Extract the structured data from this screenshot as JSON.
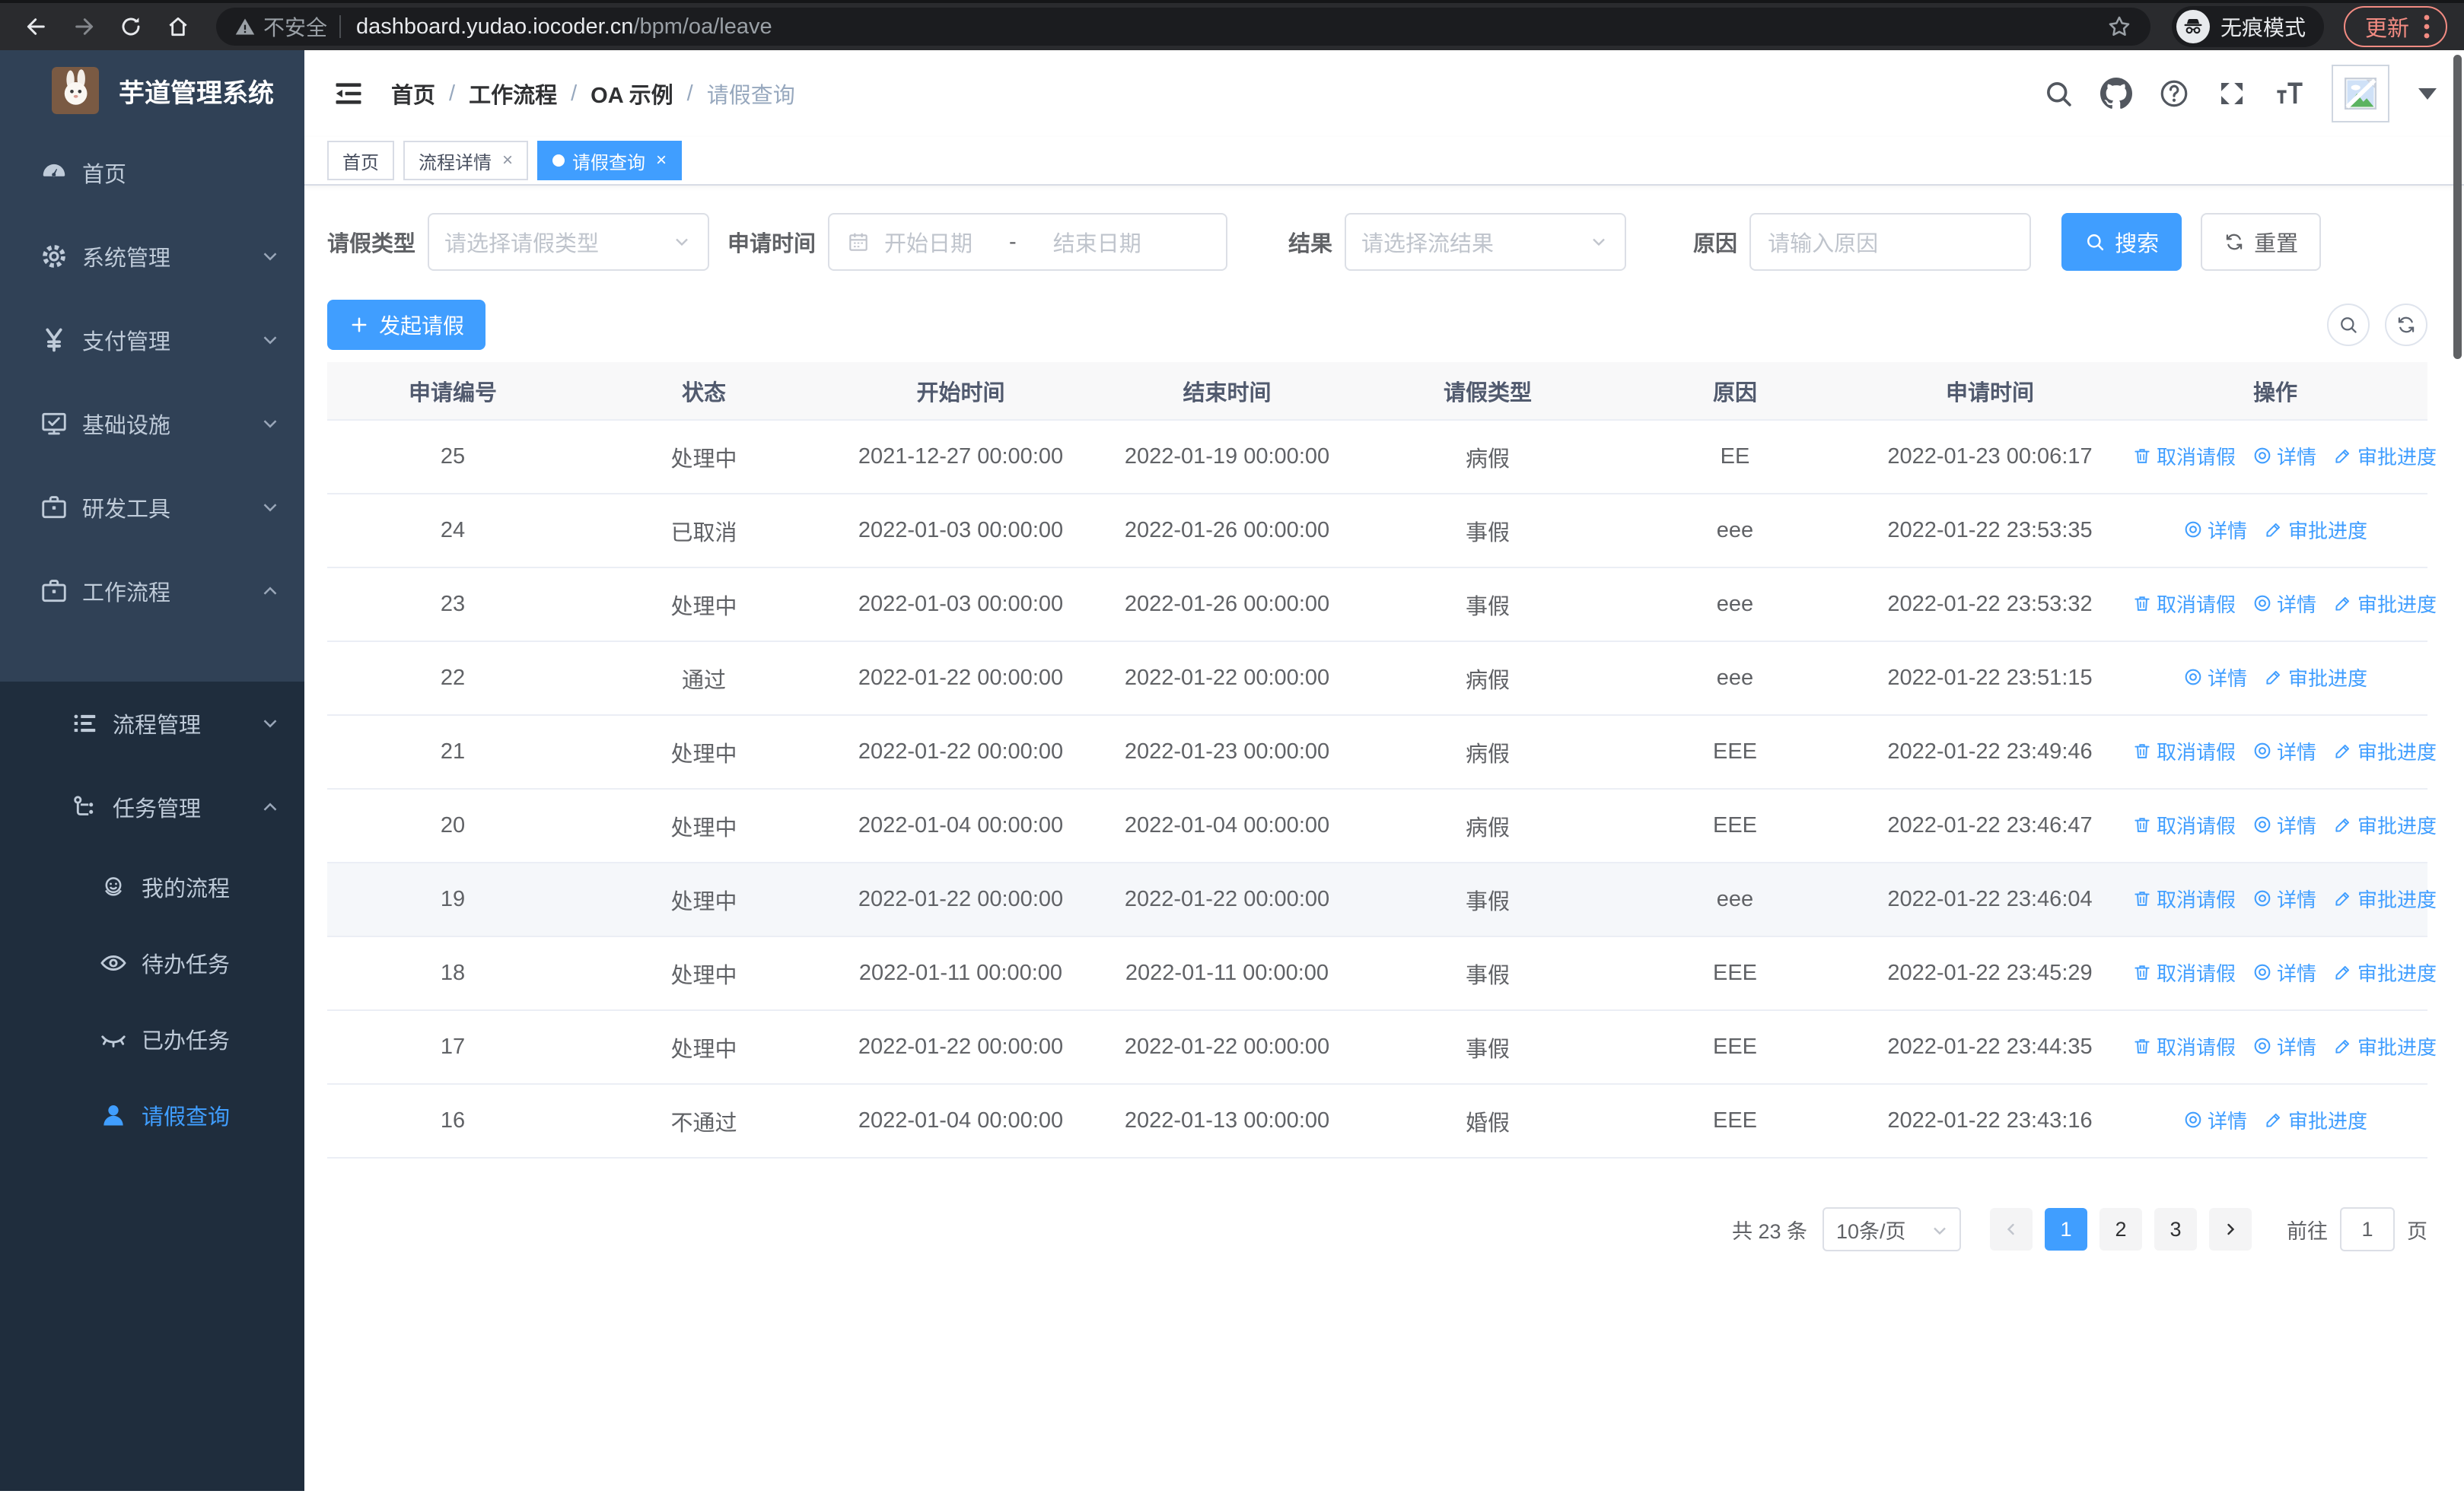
{
  "browser": {
    "security_label": "不安全",
    "url_host": "dashboard.yudao.iocoder.cn",
    "url_path": "/bpm/oa/leave",
    "incognito_label": "无痕模式",
    "update_label": "更新"
  },
  "colors": {
    "accent": "#409eff",
    "sidebar_bg": "#304156",
    "submenu_bg": "#1f2d3d",
    "sidebar_text": "#bfcbd9",
    "chrome_update": "#f28b82",
    "table_border": "#ebeef5",
    "header_bg": "#f8f8f9"
  },
  "sidebar": {
    "title": "芋道管理系统",
    "menu": [
      {
        "key": "home",
        "icon": "dashboard-icon",
        "label": "首页"
      },
      {
        "key": "system-mgmt",
        "icon": "gear-icon",
        "label": "系统管理",
        "chevron": "down"
      },
      {
        "key": "payment-mgmt",
        "icon": "yen-icon",
        "label": "支付管理",
        "chevron": "down"
      },
      {
        "key": "infrastructure",
        "icon": "monitor-icon",
        "label": "基础设施",
        "chevron": "down"
      },
      {
        "key": "dev-tools",
        "icon": "briefcase-icon",
        "label": "研发工具",
        "chevron": "down"
      },
      {
        "key": "workflow",
        "icon": "briefcase-icon",
        "label": "工作流程",
        "chevron": "up"
      }
    ],
    "submenu": [
      {
        "key": "process-mgmt",
        "icon": "list-icon",
        "label": "流程管理",
        "chevron": "down",
        "level": 1
      },
      {
        "key": "task-mgmt",
        "icon": "tree-icon",
        "label": "任务管理",
        "chevron": "up",
        "level": 1
      },
      {
        "key": "my-process",
        "icon": "face-icon",
        "label": "我的流程",
        "level": 2
      },
      {
        "key": "todo-tasks",
        "icon": "eye-icon",
        "label": "待办任务",
        "level": 2
      },
      {
        "key": "done-tasks",
        "icon": "eye-closed-icon",
        "label": "已办任务",
        "level": 2
      },
      {
        "key": "leave-query",
        "icon": "user-icon",
        "label": "请假查询",
        "level": 2,
        "active": true
      }
    ]
  },
  "header": {
    "breadcrumb": [
      "首页",
      "工作流程",
      "OA 示例",
      "请假查询"
    ]
  },
  "tabs": [
    {
      "key": "home",
      "label": "首页",
      "closable": false,
      "active": false
    },
    {
      "key": "process-detail",
      "label": "流程详情",
      "closable": true,
      "active": false
    },
    {
      "key": "leave-query",
      "label": "请假查询",
      "closable": true,
      "active": true
    }
  ],
  "filters": {
    "leave_type_label": "请假类型",
    "leave_type_placeholder": "请选择请假类型",
    "apply_time_label": "申请时间",
    "date_start_placeholder": "开始日期",
    "date_separator": "-",
    "date_end_placeholder": "结束日期",
    "result_label": "结果",
    "result_placeholder": "请选择流结果",
    "reason_label": "原因",
    "reason_placeholder": "请输入原因",
    "search_label": "搜索",
    "reset_label": "重置"
  },
  "toolbar": {
    "create_label": "发起请假"
  },
  "table": {
    "columns": [
      "申请编号",
      "状态",
      "开始时间",
      "结束时间",
      "请假类型",
      "原因",
      "申请时间",
      "操作"
    ],
    "action_labels": {
      "cancel": "取消请假",
      "detail": "详情",
      "progress": "审批进度"
    },
    "rows": [
      {
        "id": "25",
        "status": "处理中",
        "start": "2021-12-27 00:00:00",
        "end": "2022-01-19 00:00:00",
        "type": "病假",
        "reason": "EE",
        "applied": "2022-01-23 00:06:17",
        "actions": [
          "cancel",
          "detail",
          "progress"
        ],
        "hover": false
      },
      {
        "id": "24",
        "status": "已取消",
        "start": "2022-01-03 00:00:00",
        "end": "2022-01-26 00:00:00",
        "type": "事假",
        "reason": "eee",
        "applied": "2022-01-22 23:53:35",
        "actions": [
          "detail",
          "progress"
        ],
        "hover": false
      },
      {
        "id": "23",
        "status": "处理中",
        "start": "2022-01-03 00:00:00",
        "end": "2022-01-26 00:00:00",
        "type": "事假",
        "reason": "eee",
        "applied": "2022-01-22 23:53:32",
        "actions": [
          "cancel",
          "detail",
          "progress"
        ],
        "hover": false
      },
      {
        "id": "22",
        "status": "通过",
        "start": "2022-01-22 00:00:00",
        "end": "2022-01-22 00:00:00",
        "type": "病假",
        "reason": "eee",
        "applied": "2022-01-22 23:51:15",
        "actions": [
          "detail",
          "progress"
        ],
        "hover": false
      },
      {
        "id": "21",
        "status": "处理中",
        "start": "2022-01-22 00:00:00",
        "end": "2022-01-23 00:00:00",
        "type": "病假",
        "reason": "EEE",
        "applied": "2022-01-22 23:49:46",
        "actions": [
          "cancel",
          "detail",
          "progress"
        ],
        "hover": false
      },
      {
        "id": "20",
        "status": "处理中",
        "start": "2022-01-04 00:00:00",
        "end": "2022-01-04 00:00:00",
        "type": "病假",
        "reason": "EEE",
        "applied": "2022-01-22 23:46:47",
        "actions": [
          "cancel",
          "detail",
          "progress"
        ],
        "hover": false
      },
      {
        "id": "19",
        "status": "处理中",
        "start": "2022-01-22 00:00:00",
        "end": "2022-01-22 00:00:00",
        "type": "事假",
        "reason": "eee",
        "applied": "2022-01-22 23:46:04",
        "actions": [
          "cancel",
          "detail",
          "progress"
        ],
        "hover": true
      },
      {
        "id": "18",
        "status": "处理中",
        "start": "2022-01-11 00:00:00",
        "end": "2022-01-11 00:00:00",
        "type": "事假",
        "reason": "EEE",
        "applied": "2022-01-22 23:45:29",
        "actions": [
          "cancel",
          "detail",
          "progress"
        ],
        "hover": false
      },
      {
        "id": "17",
        "status": "处理中",
        "start": "2022-01-22 00:00:00",
        "end": "2022-01-22 00:00:00",
        "type": "事假",
        "reason": "EEE",
        "applied": "2022-01-22 23:44:35",
        "actions": [
          "cancel",
          "detail",
          "progress"
        ],
        "hover": false
      },
      {
        "id": "16",
        "status": "不通过",
        "start": "2022-01-04 00:00:00",
        "end": "2022-01-13 00:00:00",
        "type": "婚假",
        "reason": "EEE",
        "applied": "2022-01-22 23:43:16",
        "actions": [
          "detail",
          "progress"
        ],
        "hover": false
      }
    ]
  },
  "pagination": {
    "total_label": "共 23 条",
    "page_size": "10条/页",
    "pages": [
      "1",
      "2",
      "3"
    ],
    "active_page": "1",
    "goto_label": "前往",
    "goto_value": "1",
    "page_suffix": "页"
  }
}
